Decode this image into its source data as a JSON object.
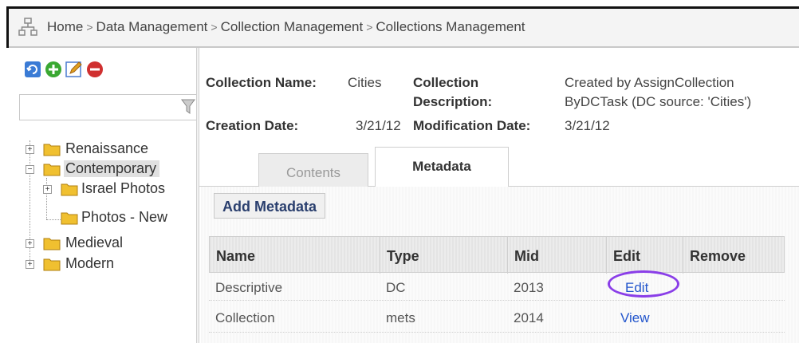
{
  "breadcrumb": {
    "icon": "sitemap-icon",
    "items": [
      "Home",
      "Data Management",
      "Collection Management",
      "Collections Management"
    ],
    "separator": ">"
  },
  "sidebar": {
    "toolbar": [
      {
        "icon": "refresh-icon",
        "color": "#3a7bd5"
      },
      {
        "icon": "add-icon",
        "color": "#3aa832"
      },
      {
        "icon": "edit-icon",
        "color": "#e0a020"
      },
      {
        "icon": "delete-icon",
        "color": "#d03030"
      }
    ],
    "filter": {
      "value": "",
      "icon": "filter-icon"
    },
    "tree": [
      {
        "label": "Renaissance",
        "expanded": false
      },
      {
        "label": "Contemporary",
        "expanded": true,
        "selected": true,
        "children": [
          {
            "label": "Israel Photos",
            "expanded": false
          },
          {
            "label": "Photos - New"
          }
        ]
      },
      {
        "label": "Medieval",
        "expanded": false
      },
      {
        "label": "Modern",
        "expanded": false
      }
    ]
  },
  "collection": {
    "name_label": "Collection Name:",
    "name_value": "Cities",
    "desc_label_1": "Collection",
    "desc_label_2": "Description:",
    "desc_value_1": "Created by AssignCollection",
    "desc_value_2": "ByDCTask (DC source: 'Cities')",
    "created_label": "Creation Date:",
    "created_value": "3/21/12",
    "modified_label": "Modification Date:",
    "modified_value": "3/21/12"
  },
  "tabs": [
    {
      "label": "Contents",
      "active": false
    },
    {
      "label": "Metadata",
      "active": true
    }
  ],
  "add_metadata_label": "Add Metadata",
  "table": {
    "headers": [
      "Name",
      "Type",
      "Mid",
      "Edit",
      "Remove"
    ],
    "rows": [
      {
        "name": "Descriptive",
        "type": "DC",
        "mid": "2013",
        "edit": "Edit"
      },
      {
        "name": "Collection",
        "type": "mets",
        "mid": "2014",
        "edit": "View"
      }
    ]
  },
  "highlight_color": "#8a3ee8"
}
